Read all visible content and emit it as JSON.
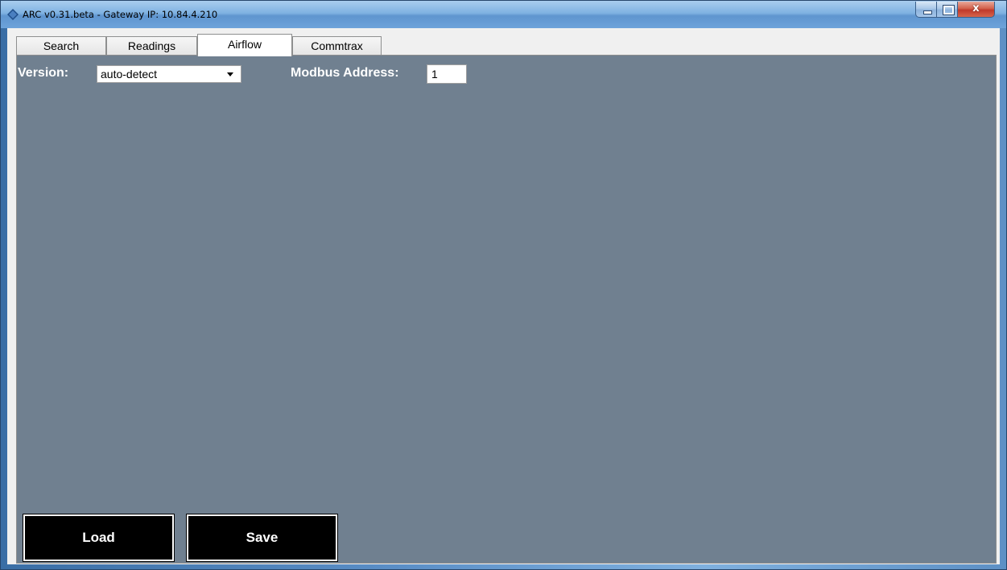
{
  "window": {
    "title": "ARC v0.31.beta - Gateway IP: 10.84.4.210",
    "close_glyph": "x"
  },
  "tabs": [
    {
      "label": "Search",
      "active": false
    },
    {
      "label": "Readings",
      "active": false
    },
    {
      "label": "Airflow",
      "active": true
    },
    {
      "label": "Commtrax",
      "active": false
    }
  ],
  "airflow": {
    "version_label": "Version:",
    "version_value": "auto-detect",
    "modbus_label": "Modbus Address:",
    "modbus_value": "1",
    "load_label": "Load",
    "save_label": "Save"
  },
  "colors": {
    "panel_background": "#708090",
    "button_background": "#000000"
  },
  "icons": {
    "app": "app-diamond-icon",
    "minimize": "minimize-icon",
    "maximize": "maximize-icon",
    "close": "close-icon",
    "dropdown": "chevron-down-icon"
  }
}
